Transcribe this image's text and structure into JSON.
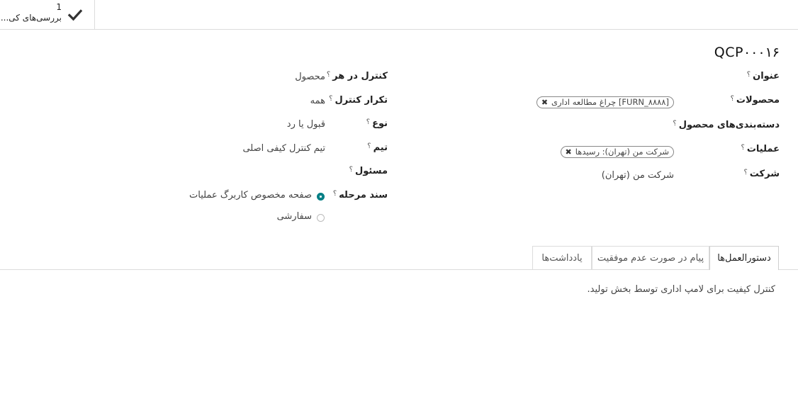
{
  "smart_button": {
    "count": "1",
    "label": "بررسی‌های کی..."
  },
  "record": {
    "reference": "QCP۰۰۰۱۶"
  },
  "form_right": {
    "title_label": "عنوان",
    "products_label": "محصولات",
    "product_tag": "[FURN_۸۸۸۸] چراغ مطالعه اداری",
    "categories_label": "دسته‌بندی‌های محصول",
    "operations_label": "عملیات",
    "operation_tag": "شرکت من (تهران): رسیدها",
    "company_label": "شرکت",
    "company_value": "شرکت من (تهران)"
  },
  "form_left": {
    "control_per_label": "کنترل در هر",
    "control_per_value": "محصول",
    "frequency_label": "تکرار کنترل",
    "frequency_value": "همه",
    "type_label": "نوع",
    "type_value": "قبول یا رد",
    "team_label": "تیم",
    "team_value": "تیم کنترل کیفی اصلی",
    "responsible_label": "مسئول",
    "step_doc_label": "سند مرحله",
    "step_option_1": "صفحه مخصوص کاربرگ عملیات",
    "step_option_2": "سفارشی"
  },
  "help_mark": "؟",
  "tag_remove": "✖",
  "tabs": [
    {
      "label": "دستورالعمل‌ها"
    },
    {
      "label": "پیام در صورت عدم موفقیت"
    },
    {
      "label": "یادداشت‌ها"
    }
  ],
  "tab_content": {
    "instructions_text": "کنترل کیفیت برای لامپ اداری توسط بخش تولید."
  },
  "colors": {
    "accent": "#017e84",
    "border": "#dcdcdc"
  }
}
